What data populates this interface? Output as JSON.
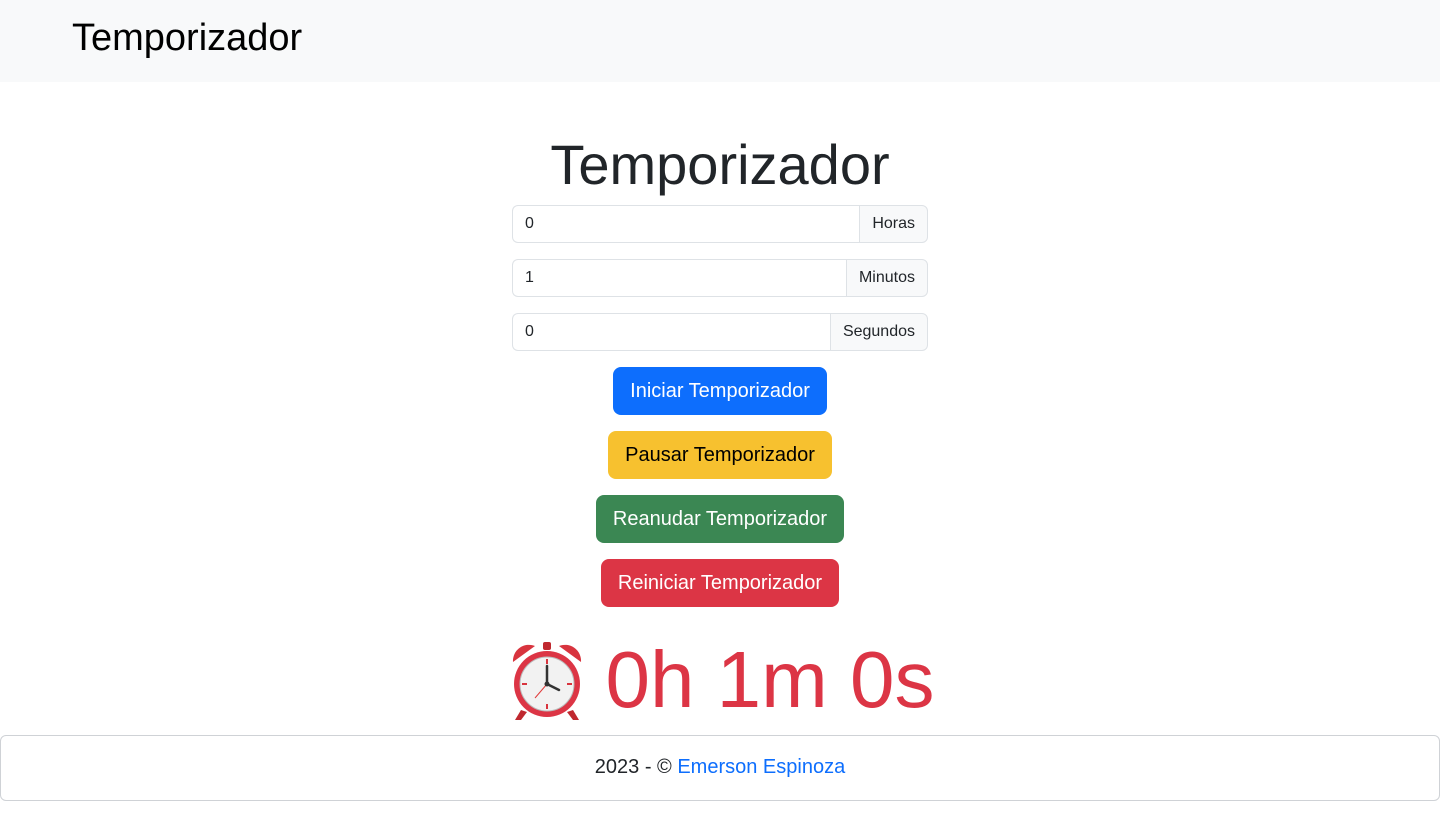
{
  "navbar": {
    "brand": "Temporizador"
  },
  "main": {
    "title": "Temporizador",
    "inputs": [
      {
        "value": "0",
        "unit": "Horas"
      },
      {
        "value": "1",
        "unit": "Minutos"
      },
      {
        "value": "0",
        "unit": "Segundos"
      }
    ],
    "buttons": {
      "start": "Iniciar Temporizador",
      "pause": "Pausar Temporizador",
      "resume": "Reanudar Temporizador",
      "reset": "Reiniciar Temporizador"
    },
    "display": {
      "icon": "alarm-clock-icon",
      "time": "0h 1m 0s"
    }
  },
  "footer": {
    "prefix": "2023 - ©",
    "author": "Emerson Espinoza"
  },
  "colors": {
    "primary": "#0d6efd",
    "warning": "#f7c12f",
    "success": "#3b8753",
    "danger": "#dc3545",
    "navbar_bg": "#f8f9fa"
  }
}
